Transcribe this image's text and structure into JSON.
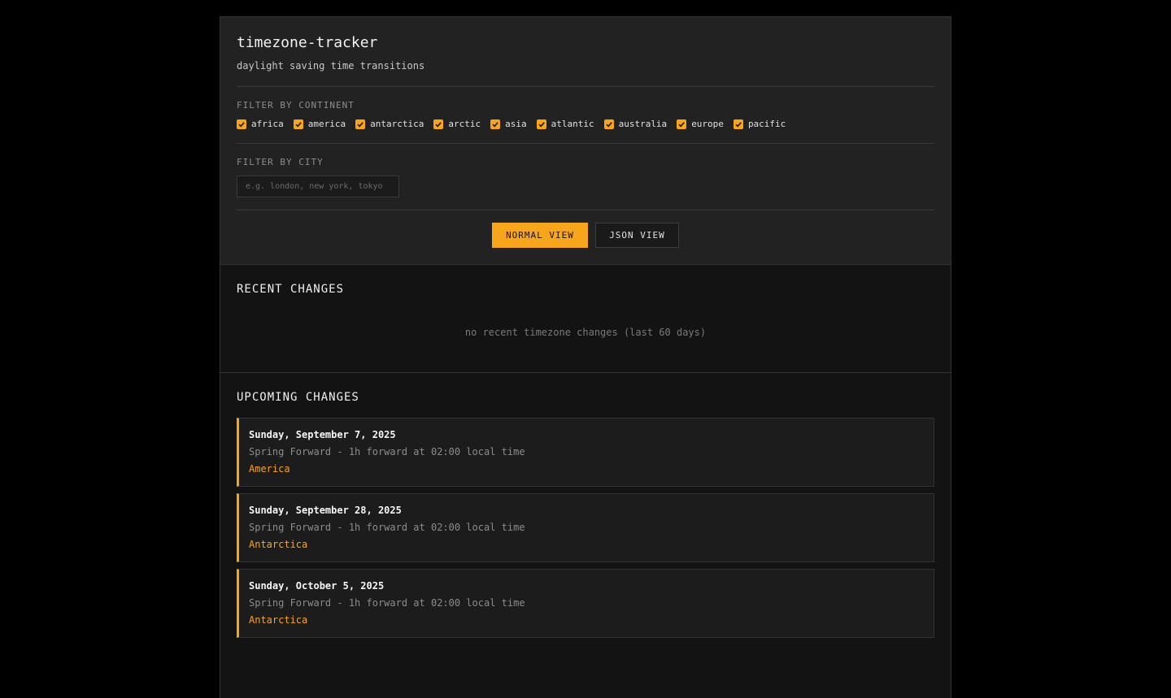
{
  "header": {
    "title": "timezone-tracker",
    "subtitle": "daylight saving time transitions"
  },
  "continent_filter": {
    "label": "FILTER BY CONTINENT",
    "options": [
      {
        "label": "africa",
        "checked": true
      },
      {
        "label": "america",
        "checked": true
      },
      {
        "label": "antarctica",
        "checked": true
      },
      {
        "label": "arctic",
        "checked": true
      },
      {
        "label": "asia",
        "checked": true
      },
      {
        "label": "atlantic",
        "checked": true
      },
      {
        "label": "australia",
        "checked": true
      },
      {
        "label": "europe",
        "checked": true
      },
      {
        "label": "pacific",
        "checked": true
      }
    ]
  },
  "city_filter": {
    "label": "FILTER BY CITY",
    "value": "",
    "placeholder": "e.g. london, new york, tokyo"
  },
  "view_toggle": {
    "normal_label": "NORMAL VIEW",
    "json_label": "JSON VIEW",
    "active": "normal"
  },
  "recent": {
    "title": "RECENT CHANGES",
    "empty_message": "no recent timezone changes (last 60 days)"
  },
  "upcoming": {
    "title": "UPCOMING CHANGES",
    "items": [
      {
        "date": "Sunday, September 7, 2025",
        "description": "Spring Forward - 1h forward at 02:00 local time",
        "region": "America"
      },
      {
        "date": "Sunday, September 28, 2025",
        "description": "Spring Forward - 1h forward at 02:00 local time",
        "region": "Antarctica"
      },
      {
        "date": "Sunday, October 5, 2025",
        "description": "Spring Forward - 1h forward at 02:00 local time",
        "region": "Antarctica"
      }
    ]
  },
  "colors": {
    "accent": "#f7a51c",
    "background": "#000000",
    "panel": "#222222",
    "section": "#131313"
  }
}
